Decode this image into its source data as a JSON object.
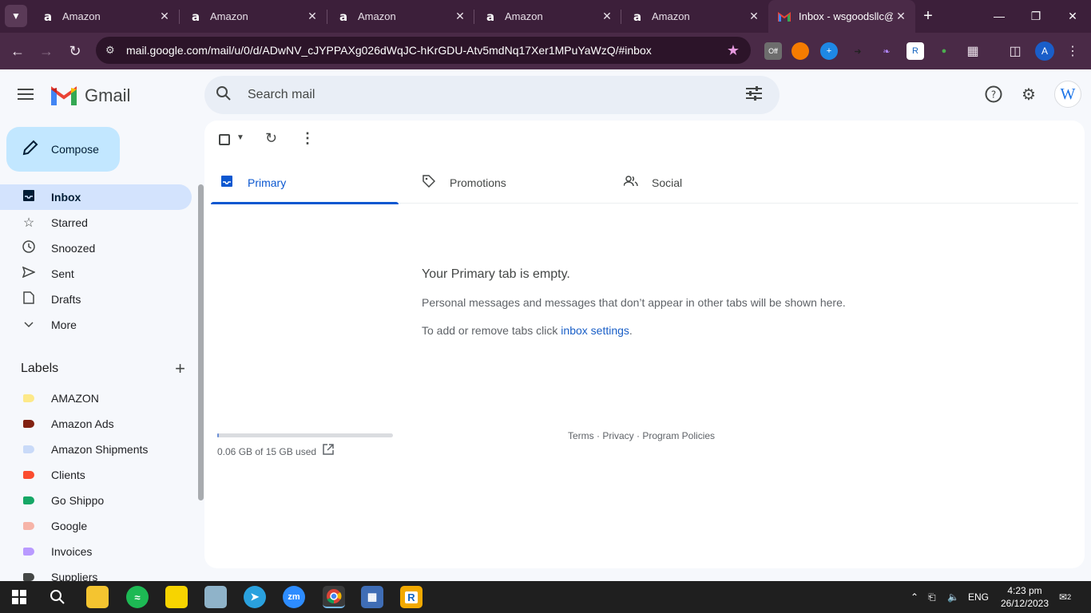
{
  "browser": {
    "tabs": [
      {
        "title": "Amazon",
        "favicon": "a"
      },
      {
        "title": "Amazon",
        "favicon": "a"
      },
      {
        "title": "Amazon",
        "favicon": "a"
      },
      {
        "title": "Amazon",
        "favicon": "a"
      },
      {
        "title": "Amazon",
        "favicon": "a"
      },
      {
        "title": "Inbox - wsgoodsllc@",
        "favicon": "gmail",
        "active": true
      }
    ],
    "url": "mail.google.com/mail/u/0/d/ADwNV_cJYPPAXg026dWqJC-hKrGDU-Atv5mdNq17Xer1MPuYaWzQ/#inbox",
    "profile_initial": "A",
    "ext_badge": "Off"
  },
  "gmail": {
    "brand": "Gmail",
    "search_placeholder": "Search mail",
    "avatar_initial": "W",
    "compose": "Compose",
    "nav": [
      {
        "label": "Inbox",
        "icon": "inbox-icon",
        "active": true
      },
      {
        "label": "Starred",
        "icon": "star-icon"
      },
      {
        "label": "Snoozed",
        "icon": "clock-icon"
      },
      {
        "label": "Sent",
        "icon": "send-icon"
      },
      {
        "label": "Drafts",
        "icon": "draft-icon"
      },
      {
        "label": "More",
        "icon": "chevron-down-icon"
      }
    ],
    "labels_heading": "Labels",
    "labels": [
      {
        "name": "AMAZON",
        "color": "#fde989"
      },
      {
        "name": "Amazon Ads",
        "color": "#822111"
      },
      {
        "name": "Amazon Shipments",
        "color": "#c9daf8"
      },
      {
        "name": "Clients",
        "color": "#fb4c2f"
      },
      {
        "name": "Go Shippo",
        "color": "#16a766"
      },
      {
        "name": "Google",
        "color": "#f6b4a8"
      },
      {
        "name": "Invoices",
        "color": "#b99aff"
      },
      {
        "name": "Suppliers",
        "color": "#444746"
      }
    ],
    "tabs": [
      {
        "label": "Primary",
        "icon": "inbox-icon",
        "active": true
      },
      {
        "label": "Promotions",
        "icon": "tag-icon"
      },
      {
        "label": "Social",
        "icon": "people-icon"
      }
    ],
    "empty": {
      "heading": "Your Primary tab is empty.",
      "line1": "Personal messages and messages that don’t appear in other tabs will be shown here.",
      "line2_prefix": "To add or remove tabs click ",
      "line2_link": "inbox settings",
      "line2_suffix": "."
    },
    "storage": {
      "text": "0.06 GB of 15 GB used",
      "used_fraction": 0.004
    },
    "footer": "Terms · Privacy · Program Policies"
  },
  "taskbar": {
    "lang": "ENG",
    "time": "4:23 pm",
    "date": "26/12/2023",
    "notifications": "2",
    "zoom_label": "zm"
  }
}
